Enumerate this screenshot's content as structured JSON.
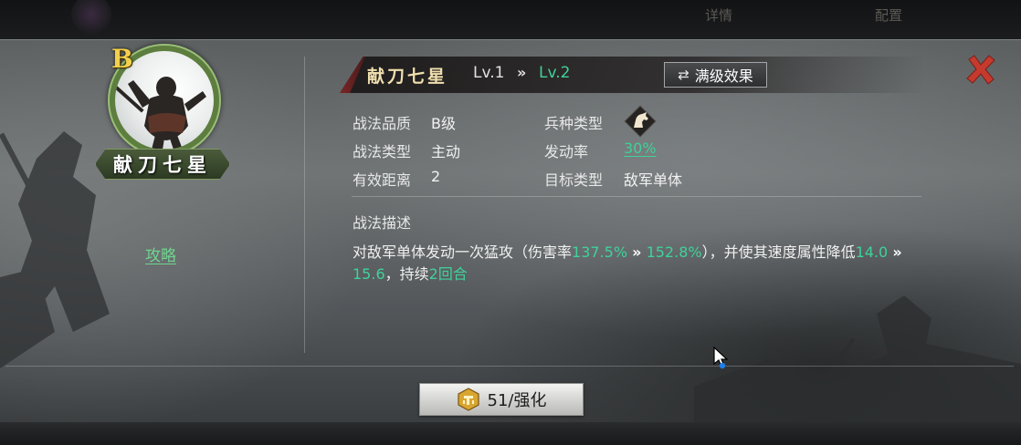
{
  "top_bar": {
    "tab_left": "详情",
    "tab_right": "配置"
  },
  "avatar": {
    "grade": "B",
    "name": "献刀七星",
    "strategy_link": "攻略"
  },
  "header": {
    "title": "献刀七星",
    "level_current": "Lv.1",
    "level_arrow": "»",
    "level_next": "Lv.2",
    "max_level_button": "满级效果",
    "max_level_icon": "⇄"
  },
  "info": {
    "quality_label": "战法品质",
    "quality_value": "B级",
    "type_label": "战法类型",
    "type_value": "主动",
    "range_label": "有效距离",
    "range_value": "2",
    "troop_label": "兵种类型",
    "troop_icon": "cavalry-horse-icon",
    "rate_label": "发动率",
    "rate_value": "30%",
    "target_label": "目标类型",
    "target_value": "敌军单体"
  },
  "description": {
    "title": "战法描述",
    "part1": "对敌军单体发动一次猛攻（伤害率",
    "dmg_from": "137.5%",
    "arrow1": "»",
    "dmg_to": "152.8%",
    "part2": "），并使其速度属性降低",
    "spd_from": "14.0",
    "arrow2": "»",
    "spd_to": "15.6",
    "part3": "，持续",
    "duration": "2回合"
  },
  "enhance_button": {
    "label": "51/强化",
    "icon": "coin-icon"
  },
  "colors": {
    "accent_green": "#3fd29a",
    "link_green": "#6fd58f",
    "grade_gold": "#f3d04c",
    "close_red": "#c0392b"
  }
}
